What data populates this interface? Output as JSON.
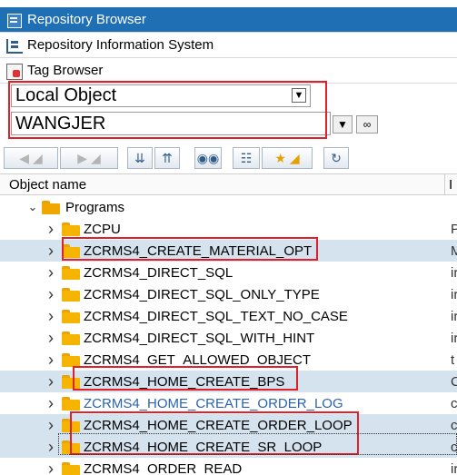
{
  "nav": {
    "repository_browser": "Repository Browser",
    "repository_info_system": "Repository Information System",
    "tag_browser": "Tag Browser"
  },
  "filter": {
    "object_type": "Local Object",
    "user_name": "WANGJER"
  },
  "table": {
    "column_object_name": "Object name",
    "column_second": "I"
  },
  "tree": {
    "root_label": "Programs",
    "items": [
      {
        "label": "ZCPU",
        "trail": "P"
      },
      {
        "label": "ZCRMS4_CREATE_MATERIAL_OPT",
        "trail": "M"
      },
      {
        "label": "ZCRMS4_DIRECT_SQL",
        "trail": "ir"
      },
      {
        "label": "ZCRMS4_DIRECT_SQL_ONLY_TYPE",
        "trail": "ir"
      },
      {
        "label": "ZCRMS4_DIRECT_SQL_TEXT_NO_CASE",
        "trail": "ir"
      },
      {
        "label": "ZCRMS4_DIRECT_SQL_WITH_HINT",
        "trail": "ir"
      },
      {
        "label": "ZCRMS4_GET_ALLOWED_OBJECT",
        "trail": "t"
      },
      {
        "label": "ZCRMS4_HOME_CREATE_BPS",
        "trail": "C"
      },
      {
        "label": "ZCRMS4_HOME_CREATE_ORDER_LOG",
        "trail": "c"
      },
      {
        "label": "ZCRMS4_HOME_CREATE_ORDER_LOOP",
        "trail": "c"
      },
      {
        "label": "ZCRMS4_HOME_CREATE_SR_LOOP",
        "trail": "c"
      },
      {
        "label": "ZCRMS4_ORDER_READ",
        "trail": "ir"
      }
    ]
  },
  "icons": {
    "repository_browser": "repository-icon",
    "repository_info_system": "hierarchy-icon",
    "tag_browser": "tag-icon",
    "back": "arrow-left-icon",
    "forward": "arrow-right-icon",
    "collapse": "chevrons-down-icon",
    "expand": "chevrons-up-icon",
    "binoculars": "binoculars-icon",
    "hierarchy": "hierarchy-icon",
    "favorite": "star-icon",
    "refresh": "refresh-icon"
  },
  "colors": {
    "accent": "#1f6fb5",
    "highlight_box": "#e0202a",
    "selected_row": "#d5e3ef",
    "folder": "#f5b400"
  }
}
